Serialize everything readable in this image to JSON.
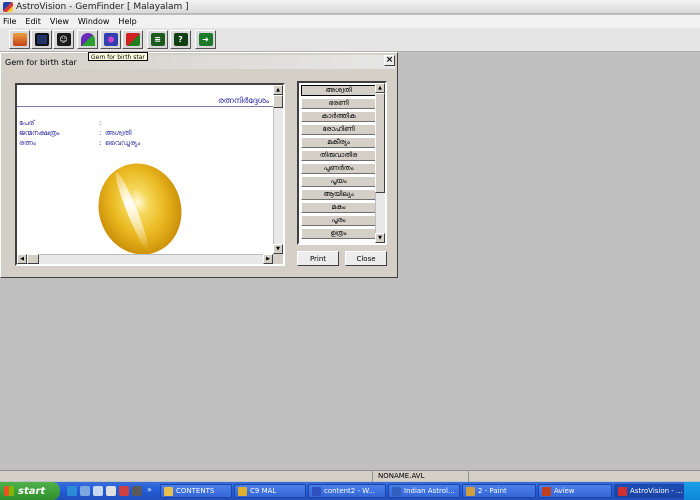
{
  "window": {
    "title": "AstroVision - GemFinder [ Malayalam ]"
  },
  "menu": [
    "File",
    "Edit",
    "View",
    "Window",
    "Help"
  ],
  "toolbar": {
    "buttons": [
      {
        "icon": "open-folder-icon",
        "color": "#d04020"
      },
      {
        "icon": "save-disk-icon",
        "color": "#203060"
      },
      {
        "icon": "person-icon",
        "color": "#305080"
      },
      {
        "icon": "gem-icon",
        "color": "#2a8a2a"
      },
      {
        "icon": "gem-multi-icon",
        "color": "#7040a0"
      },
      {
        "icon": "export-icon",
        "color": "#c02020"
      },
      {
        "icon": "notes-icon",
        "color": "#206020"
      },
      {
        "icon": "help-icon",
        "color": "#105010"
      },
      {
        "icon": "exit-icon",
        "color": "#208030"
      }
    ],
    "tooltip": "Gem for birth star"
  },
  "dialog": {
    "title": "Gem for birth star",
    "close_label": "×",
    "document": {
      "heading": "രത്നനിർദ്ദേശം",
      "fields": [
        {
          "label": "പേര്",
          "value": ""
        },
        {
          "label": "ജന്മനക്ഷത്രം",
          "value": "അശ്വതി"
        },
        {
          "label": "രത്നം",
          "value": "വൈഡൂര്യം"
        }
      ]
    },
    "stars": [
      "അശ്വതി",
      "ഭരണി",
      "കാർത്തിക",
      "രോഹിണി",
      "മകീര്യം",
      "തിരുവാതിര",
      "പുണർതം",
      "പൂയം",
      "ആയില്യം",
      "മകം",
      "പൂരം",
      "ഉത്രം"
    ],
    "selected_star": "അശ്വതി",
    "print_label": "Print",
    "close_button_label": "Close"
  },
  "statusbar": {
    "file": "NONAME.AVL"
  },
  "taskbar": {
    "start_label": "start",
    "tasks": [
      {
        "label": "CONTENTS",
        "color": "#e8c050"
      },
      {
        "label": "C9 MAL",
        "color": "#e0b030"
      },
      {
        "label": "content2 - W...",
        "color": "#3050c0"
      },
      {
        "label": "Indian Astrol...",
        "color": "#3060c0"
      },
      {
        "label": "2 - Paint",
        "color": "#d0a040"
      },
      {
        "label": "Aview",
        "color": "#c04020"
      },
      {
        "label": "AstroVision - ...",
        "color": "#d03030"
      }
    ]
  }
}
